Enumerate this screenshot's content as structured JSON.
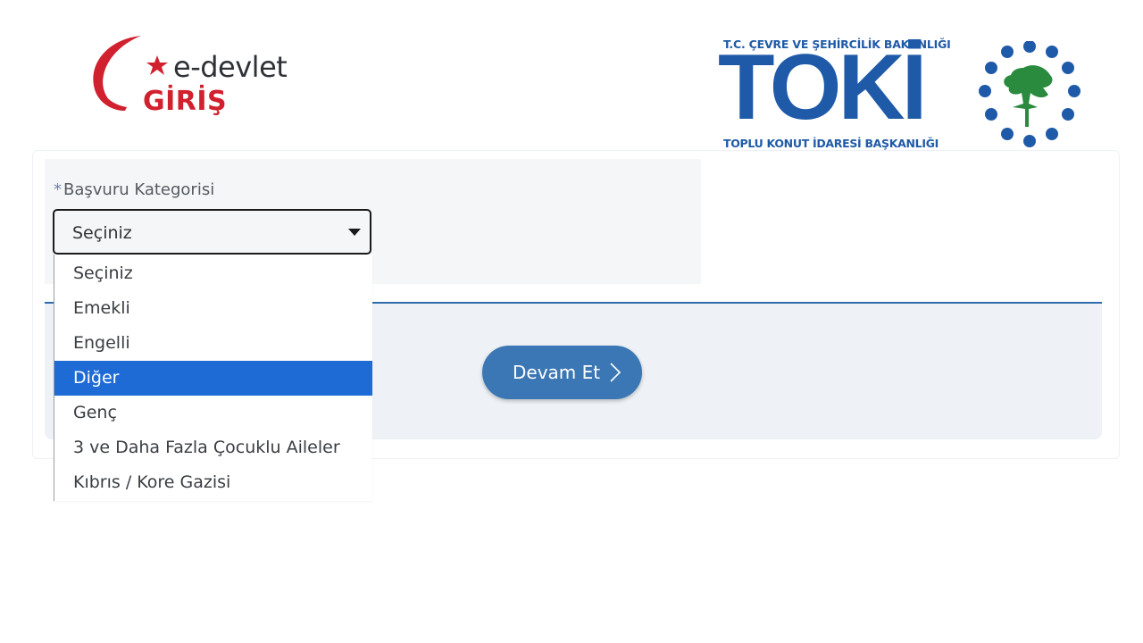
{
  "header": {
    "edevlet": {
      "top_text": "e-devlet",
      "bottom_text": "GİRİŞ",
      "brand_color": "#d1202e"
    },
    "toki": {
      "ministry": "T.C. ÇEVRE VE ŞEHİRCİLİK BAKANLIĞI",
      "name": "TOKİ",
      "agency": "TOPLU KONUT İDARESİ BAŞKANLIĞI",
      "brand_color": "#1f5aa8",
      "emblem_color": "#2a8a3e"
    }
  },
  "form": {
    "required_mark": "*",
    "category_label": "Başvuru Kategorisi",
    "category_selected": "Seçiniz",
    "dropdown_icon": "caret-down-icon",
    "options": [
      {
        "label": "Seçiniz"
      },
      {
        "label": "Emekli"
      },
      {
        "label": "Engelli"
      },
      {
        "label": "Diğer"
      },
      {
        "label": "Genç"
      },
      {
        "label": "3 ve Daha Fazla Çocuklu Aileler"
      },
      {
        "label": "Kıbrıs / Kore Gazisi"
      }
    ],
    "highlighted_option": "Diğer",
    "continue_button": "Devam Et",
    "continue_icon": "chevron-right-icon",
    "accent_color": "#3b77b4",
    "highlight_color": "#1e6bd6"
  }
}
